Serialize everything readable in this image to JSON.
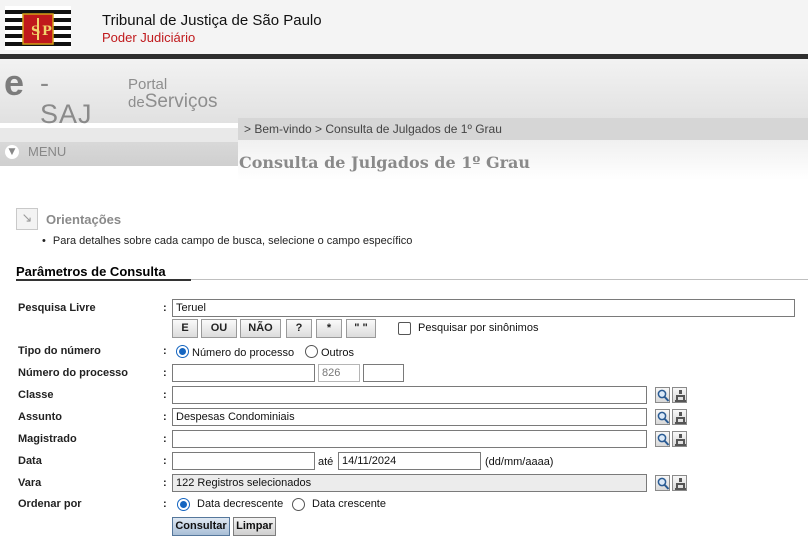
{
  "header": {
    "org_name": "Tribunal de Justiça de São Paulo",
    "org_sub": "Poder Judiciário",
    "logo_icon": "tjsp-coat-of-arms-icon"
  },
  "portal": {
    "brand_e": "e",
    "brand_saj": "-SAJ",
    "portal_line1": "Portal",
    "portal_line2_de": "de",
    "portal_line2_servicos": "Serviços"
  },
  "menu": {
    "label": "MENU"
  },
  "breadcrumb": "> Bem-vindo > Consulta de Julgados de 1º Grau",
  "page_title": "Consulta de Julgados de 1º Grau",
  "orientacoes": {
    "title": "Orientações",
    "text": "Para detalhes sobre cada campo de busca, selecione o campo específico"
  },
  "parametros": {
    "title": "Parâmetros de Consulta",
    "pesquisa_livre": {
      "label": "Pesquisa Livre",
      "value": "Teruel",
      "operators": [
        "E",
        "OU",
        "NÃO",
        "?",
        "*",
        "\" \""
      ],
      "sinonimos_label": "Pesquisar por sinônimos",
      "sinonimos_checked": false
    },
    "tipo_numero": {
      "label": "Tipo do número",
      "options": [
        "Número do processo",
        "Outros"
      ],
      "selected": "Número do processo"
    },
    "numero_processo": {
      "label": "Número do processo",
      "part1": "",
      "part2": "826",
      "part3": ""
    },
    "classe": {
      "label": "Classe",
      "value": ""
    },
    "assunto": {
      "label": "Assunto",
      "value": "Despesas Condominiais"
    },
    "magistrado": {
      "label": "Magistrado",
      "value": ""
    },
    "data": {
      "label": "Data",
      "from": "",
      "ate_label": "até",
      "to": "14/11/2024",
      "format_hint": "(dd/mm/aaaa)"
    },
    "vara": {
      "label": "Vara",
      "value": "122 Registros selecionados"
    },
    "ordenar_por": {
      "label": "Ordenar por",
      "options": [
        "Data decrescente",
        "Data crescente"
      ],
      "selected": "Data decrescente"
    }
  },
  "colon": ":",
  "actions": {
    "consultar": "Consultar",
    "limpar": "Limpar"
  },
  "colors": {
    "brand_red": "#c0191c",
    "radio_blue": "#1565c0"
  }
}
